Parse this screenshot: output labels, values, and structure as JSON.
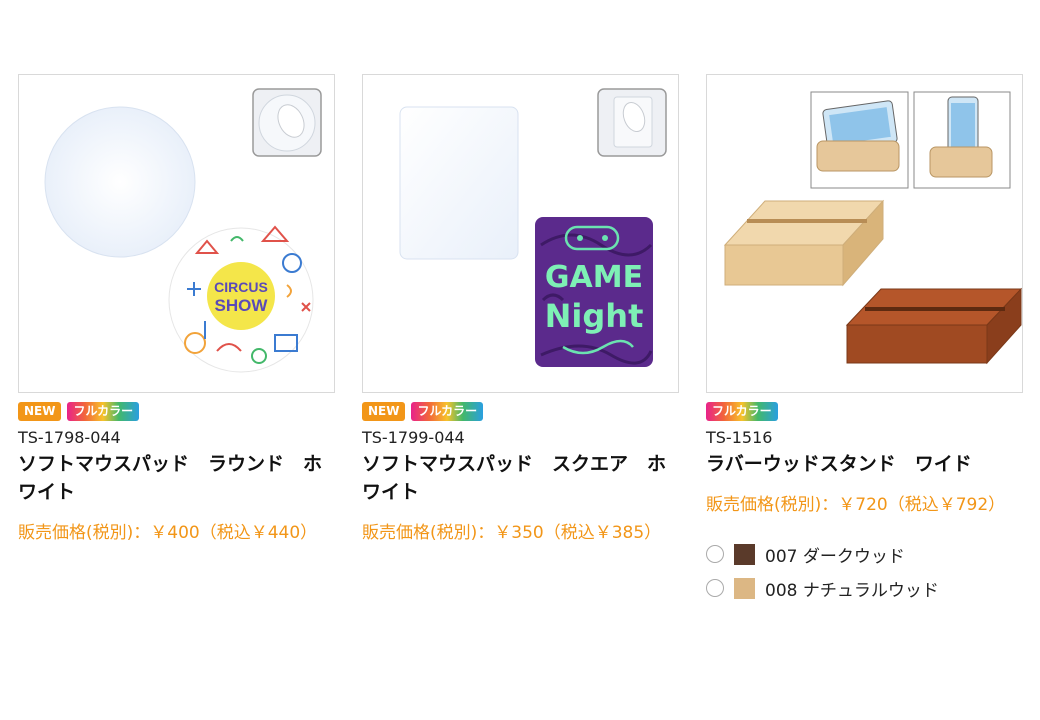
{
  "products": [
    {
      "badges": {
        "new": "NEW",
        "full_color": "フルカラー"
      },
      "code": "TS-1798-044",
      "name": "ソフトマウスパッド　ラウンド　ホワイト",
      "price": "販売価格(税別)：￥400（税込￥440）"
    },
    {
      "badges": {
        "new": "NEW",
        "full_color": "フルカラー"
      },
      "code": "TS-1799-044",
      "name": "ソフトマウスパッド　スクエア　ホワイト",
      "price": "販売価格(税別)：￥350（税込￥385）"
    },
    {
      "badges": {
        "full_color": "フルカラー"
      },
      "code": "TS-1516",
      "name": "ラバーウッドスタンド　ワイド",
      "price": "販売価格(税別)：￥720（税込￥792）",
      "colors": [
        {
          "label": "007 ダークウッド",
          "swatch": "#5a3a2a"
        },
        {
          "label": "008 ナチュラルウッド",
          "swatch": "#dcb784"
        }
      ]
    }
  ],
  "image_text": {
    "circus_1": "CIRCUS",
    "circus_2": "SHOW",
    "game_1": "GAME",
    "game_2": "Night"
  }
}
